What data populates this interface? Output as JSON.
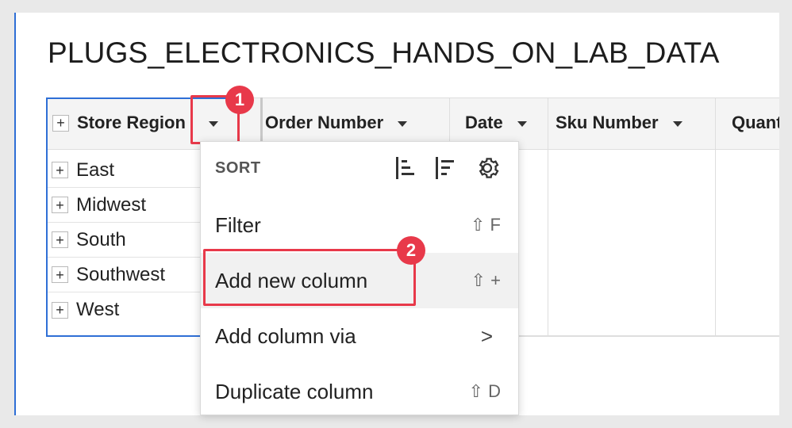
{
  "page": {
    "title": "PLUGS_ELECTRONICS_HANDS_ON_LAB_DATA"
  },
  "table": {
    "columns": [
      {
        "label": "Store Region"
      },
      {
        "label": "Order Number"
      },
      {
        "label": "Date"
      },
      {
        "label": "Sku Number"
      },
      {
        "label": "Quantity"
      }
    ],
    "rows": [
      "East",
      "Midwest",
      "South",
      "Southwest",
      "West"
    ],
    "expand_symbol": "+"
  },
  "menu": {
    "sort_label": "SORT",
    "items": [
      {
        "label": "Filter",
        "shortcut": "⇧ F"
      },
      {
        "label": "Add new column",
        "shortcut": "⇧ +"
      },
      {
        "label": "Add column via",
        "shortcut": ">"
      },
      {
        "label": "Duplicate column",
        "shortcut": "⇧ D"
      }
    ]
  },
  "callouts": {
    "step1": "1",
    "step2": "2"
  },
  "colors": {
    "accent": "#2f6fd6",
    "callout": "#e8394a"
  }
}
